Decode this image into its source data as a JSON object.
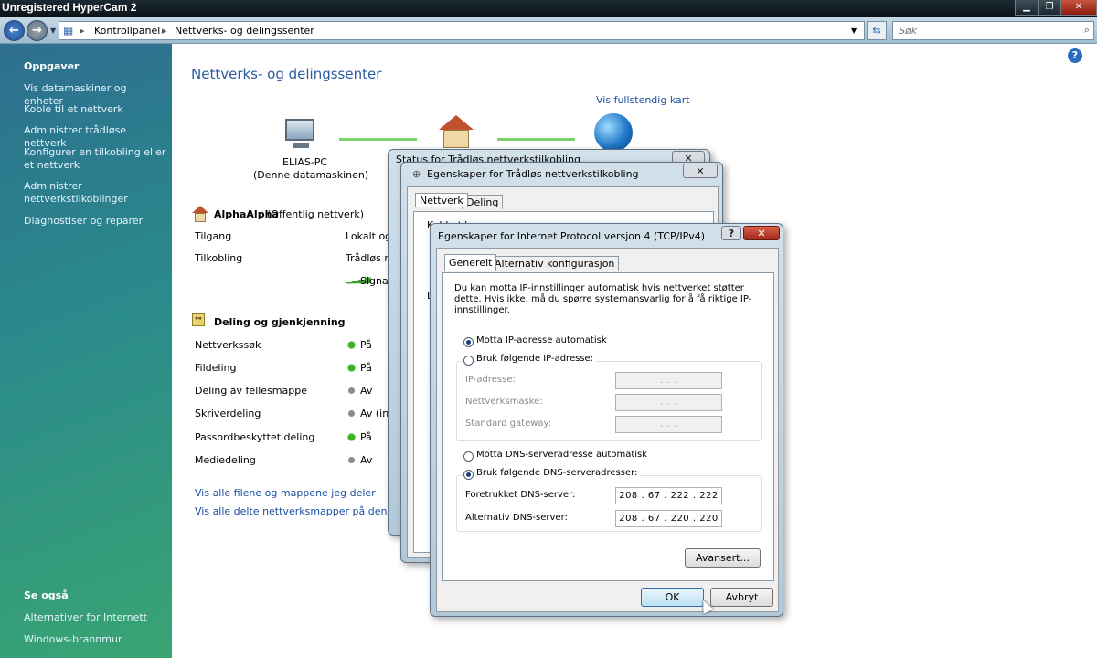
{
  "watermark": "Unregistered HyperCam 2",
  "breadcrumb": {
    "root": "Kontrollpanel",
    "current": "Nettverks- og delingssenter",
    "sep": "▸"
  },
  "search": {
    "placeholder": "Søk"
  },
  "sidebar": {
    "tasks_title": "Oppgaver",
    "items": [
      {
        "label": "Vis datamaskiner og enheter"
      },
      {
        "label": "Koble til et nettverk"
      },
      {
        "label": "Administrer trådløse nettverk"
      },
      {
        "label": "Konfigurer en tilkobling eller et nettverk"
      },
      {
        "label": "Administrer nettverkstilkoblinger"
      },
      {
        "label": "Diagnostiser og reparer"
      }
    ],
    "see_also_title": "Se også",
    "see_also": [
      {
        "label": "Alternativer for Internett"
      },
      {
        "label": "Windows-brannmur"
      }
    ]
  },
  "main": {
    "title": "Nettverks- og delingssenter",
    "full_map_link": "Vis fullstendig kart",
    "computer_name": "ELIAS-PC",
    "computer_sub": "(Denne datamaskinen)",
    "network_name": "AlphaAlpha",
    "network_type": "(Offentlig nettverk)",
    "access_label": "Tilgang",
    "access_value": "Lokalt og",
    "connection_label": "Tilkobling",
    "connection_value": "Trådløs n",
    "signal_value": "Signa",
    "sharing_title": "Deling og gjenkjenning",
    "sharing_rows": [
      {
        "label": "Nettverkssøk",
        "value": "På",
        "status": "on"
      },
      {
        "label": "Fildeling",
        "value": "På",
        "status": "on"
      },
      {
        "label": "Deling av fellesmappe",
        "value": "Av",
        "status": "off"
      },
      {
        "label": "Skriverdeling",
        "value": "Av (in",
        "status": "off"
      },
      {
        "label": "Passordbeskyttet deling",
        "value": "På",
        "status": "on"
      },
      {
        "label": "Mediedeling",
        "value": "Av",
        "status": "off"
      }
    ],
    "link_files": "Vis alle filene og mappene jeg deler",
    "link_folders": "Vis alle delte nettverksmapper på denne da"
  },
  "status_dialog": {
    "title": "Status for Trådløs nettverkstilkobling"
  },
  "props_dialog": {
    "title": "Egenskaper for Trådløs nettverkstilkobling",
    "tabs": [
      "Nettverk",
      "Deling"
    ],
    "fragment1": "Koble til",
    "fragment2": "D"
  },
  "ipv4_dialog": {
    "title": "Egenskaper for Internet Protocol versjon 4 (TCP/IPv4)",
    "tabs": [
      "Generelt",
      "Alternativ konfigurasjon"
    ],
    "info": "Du kan motta IP-innstillinger automatisk hvis nettverket støtter dette. Hvis ikke, må du spørre systemansvarlig for å få riktige IP-innstillinger.",
    "auto_ip": "Motta IP-adresse automatisk",
    "manual_ip": "Bruk følgende IP-adresse:",
    "ip_label": "IP-adresse:",
    "mask_label": "Nettverksmaske:",
    "gateway_label": "Standard gateway:",
    "empty_ip": ".       .       .",
    "auto_dns": "Motta DNS-serveradresse automatisk",
    "manual_dns": "Bruk følgende DNS-serveradresser:",
    "pref_dns_label": "Foretrukket DNS-server:",
    "pref_dns": "208 .  67  . 222 . 222",
    "alt_dns_label": "Alternativ DNS-server:",
    "alt_dns": "208 .  67  . 220 . 220",
    "advanced": "Avansert...",
    "ok": "OK",
    "cancel": "Avbryt",
    "selected_ip_mode": "auto",
    "selected_dns_mode": "manual"
  }
}
